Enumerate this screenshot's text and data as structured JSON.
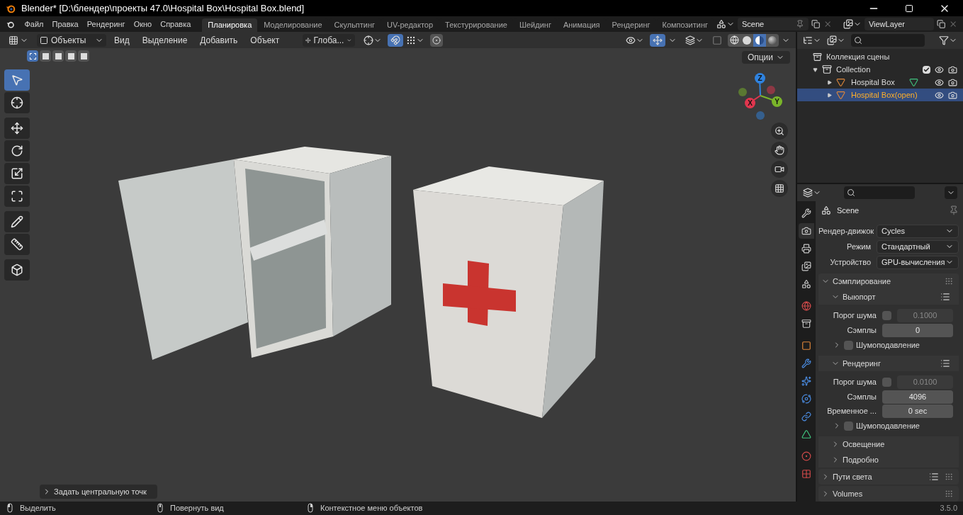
{
  "title": "Blender* [D:\\блендер\\проекты 47.0\\Hospital Box\\Hospital Box.blend]",
  "menu": [
    "Файл",
    "Правка",
    "Рендеринг",
    "Окно",
    "Справка"
  ],
  "workspaces": [
    {
      "label": "Планировка",
      "selected": true
    },
    {
      "label": "Моделирование",
      "selected": false
    },
    {
      "label": "Скульптинг",
      "selected": false
    },
    {
      "label": "UV-редактор",
      "selected": false
    },
    {
      "label": "Текстурирование",
      "selected": false
    },
    {
      "label": "Шейдинг",
      "selected": false
    },
    {
      "label": "Анимация",
      "selected": false
    },
    {
      "label": "Рендеринг",
      "selected": false
    },
    {
      "label": "Композитинг",
      "selected": false
    }
  ],
  "scene": "Scene",
  "view_layer": "ViewLayer",
  "viewport": {
    "mode": "Объекты",
    "menus": [
      "Вид",
      "Выделение",
      "Добавить",
      "Объект"
    ],
    "orientation": "Глоба...",
    "options": "Опции",
    "snap_on": true,
    "select_modes": [
      {
        "selected": true
      },
      {
        "selected": false
      },
      {
        "selected": false
      },
      {
        "selected": false
      },
      {
        "selected": false
      }
    ],
    "shading": [
      {
        "kind": "wire",
        "selected": false
      },
      {
        "kind": "solid",
        "selected": false
      },
      {
        "kind": "material",
        "selected": true
      },
      {
        "kind": "rendered",
        "selected": false
      }
    ],
    "tools": [
      {
        "kind": "select",
        "selected": true
      },
      {
        "kind": "cursor",
        "selected": false
      },
      {
        "kind": "move",
        "selected": false
      },
      {
        "kind": "rotate",
        "selected": false
      },
      {
        "kind": "scale",
        "selected": false
      },
      {
        "kind": "transform",
        "selected": false
      },
      {
        "kind": "annotate",
        "selected": false
      },
      {
        "kind": "measure",
        "selected": false
      },
      {
        "kind": "add_cube",
        "selected": false
      }
    ],
    "gizmo": [
      {
        "label": "Z",
        "color": "#2f83e0"
      },
      {
        "label": "Y",
        "color": "#7ab52a"
      },
      {
        "label": "X",
        "color": "#e0364e"
      }
    ],
    "last_operator": "Задать центральную точк"
  },
  "outliner": {
    "root": "Коллекция сцены",
    "items": [
      {
        "label": "Collection",
        "kind": "collection",
        "expanded": true,
        "checked": true,
        "selected": false,
        "children": [
          {
            "label": "Hospital Box",
            "kind": "mesh",
            "expanded": false,
            "selected": false,
            "show_data": true
          },
          {
            "label": "Hospital Box(open)",
            "kind": "mesh",
            "expanded": false,
            "selected": true,
            "show_data": false
          }
        ]
      }
    ]
  },
  "properties": {
    "context": "Scene",
    "tabs": [
      {
        "kind": "tool",
        "selected": false
      },
      {
        "kind": "render",
        "selected": true
      },
      {
        "kind": "output",
        "selected": false
      },
      {
        "kind": "view_layer",
        "selected": false
      },
      {
        "kind": "scene",
        "selected": false
      },
      {
        "kind": "world",
        "selected": false
      },
      {
        "kind": "collection",
        "selected": false
      },
      {
        "kind": "object",
        "selected": false
      },
      {
        "kind": "modifier",
        "selected": false
      },
      {
        "kind": "particles",
        "selected": false
      },
      {
        "kind": "physics",
        "selected": false
      },
      {
        "kind": "constraints",
        "selected": false
      },
      {
        "kind": "data",
        "selected": false
      },
      {
        "kind": "material",
        "selected": false
      },
      {
        "kind": "texture",
        "selected": false
      }
    ],
    "fields": [
      {
        "label": "Рендер-движок",
        "value": "Cycles"
      },
      {
        "label": "Режим",
        "value": "Стандартный"
      },
      {
        "label": "Устройство",
        "value": "GPU-вычисления"
      }
    ],
    "panels": [
      {
        "title": "Сэмплирование",
        "expanded": true,
        "children": [
          {
            "kind": "subpanel",
            "title": "Выюпорт",
            "expanded": true,
            "presets": true,
            "children": [
              {
                "kind": "threshold",
                "label": "Порог шума",
                "checked": false,
                "value": "0.1000"
              },
              {
                "kind": "number",
                "label": "Сэмплы",
                "value": "0"
              },
              {
                "kind": "checkpanel",
                "title": "Шумоподавление",
                "checked": false,
                "expanded": false
              }
            ]
          },
          {
            "kind": "subpanel",
            "title": "Рендеринг",
            "expanded": true,
            "presets": true,
            "children": [
              {
                "kind": "threshold",
                "label": "Порог шума",
                "checked": false,
                "value": "0.0100"
              },
              {
                "kind": "number",
                "label": "Сэмплы",
                "value": "4096"
              },
              {
                "kind": "number",
                "label": "Временное ...",
                "value": "0 sec"
              },
              {
                "kind": "checkpanel",
                "title": "Шумоподавление",
                "checked": false,
                "expanded": false
              }
            ]
          },
          {
            "kind": "subpanel",
            "title": "Освещение",
            "expanded": false,
            "presets": false
          },
          {
            "kind": "subpanel",
            "title": "Подробно",
            "expanded": false,
            "presets": false
          }
        ]
      },
      {
        "title": "Пути света",
        "expanded": false,
        "presets": true
      },
      {
        "title": "Volumes",
        "expanded": false,
        "presets": false
      }
    ]
  },
  "status_bar": {
    "hints": [
      {
        "kind": "left",
        "label": "Выделить"
      },
      {
        "kind": "middle",
        "label": "Повернуть вид"
      },
      {
        "kind": "right",
        "label": "Контекстное меню объектов"
      }
    ],
    "version": "3.5.0"
  }
}
